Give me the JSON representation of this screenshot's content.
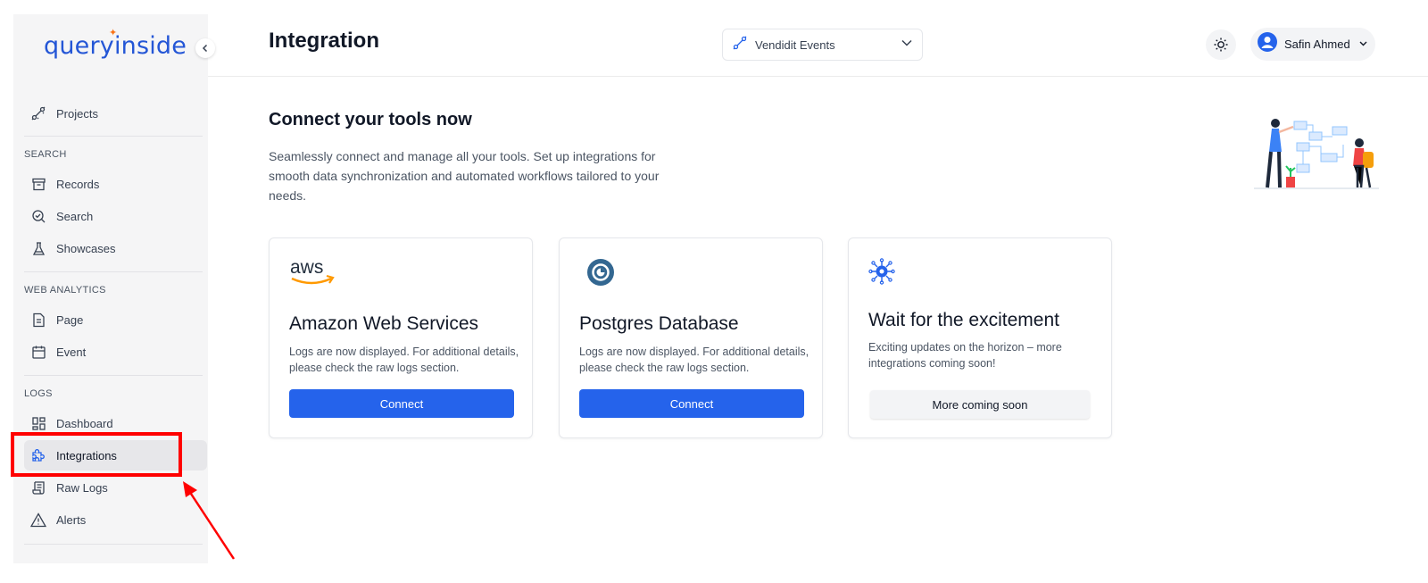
{
  "app": {
    "logo_text": "queryinside"
  },
  "sidebar": {
    "projects": {
      "label": "Projects",
      "icon": "plug-icon"
    },
    "sections": [
      {
        "title": "SEARCH",
        "items": [
          {
            "label": "Records",
            "icon": "archive-icon"
          },
          {
            "label": "Search",
            "icon": "search-icon"
          },
          {
            "label": "Showcases",
            "icon": "flask-icon"
          }
        ]
      },
      {
        "title": "WEB ANALYTICS",
        "items": [
          {
            "label": "Page",
            "icon": "file-icon"
          },
          {
            "label": "Event",
            "icon": "calendar-icon"
          }
        ]
      },
      {
        "title": "LOGS",
        "items": [
          {
            "label": "Dashboard",
            "icon": "dashboard-icon"
          },
          {
            "label": "Integrations",
            "icon": "puzzle-icon",
            "active": true
          },
          {
            "label": "Raw Logs",
            "icon": "scroll-icon"
          },
          {
            "label": "Alerts",
            "icon": "alert-icon"
          }
        ]
      }
    ]
  },
  "header": {
    "title": "Integration",
    "project_select": {
      "value": "Vendidit Events"
    },
    "user": {
      "name": "Safin Ahmed"
    }
  },
  "hero": {
    "title": "Connect your tools now",
    "description": "Seamlessly connect and manage all your tools. Set up integrations for smooth data synchronization and automated workflows tailored to your needs."
  },
  "cards": [
    {
      "logo": "aws-logo",
      "title": "Amazon Web Services",
      "description": "Logs are now displayed. For additional details, please check the raw logs section.",
      "button": "Connect"
    },
    {
      "logo": "postgres-logo",
      "title": "Postgres Database",
      "description": "Logs are now displayed. For additional details, please check the raw logs section.",
      "button": "Connect"
    },
    {
      "logo": "integration-cog-icon",
      "title": "Wait for the excitement",
      "description": "Exciting updates on the horizon – more integrations coming soon!",
      "button": "More coming soon"
    }
  ],
  "colors": {
    "primary": "#2563eb",
    "annotation": "#ff0000",
    "logo": "#2456d6",
    "sidebar_bg": "#f5f5f6"
  }
}
